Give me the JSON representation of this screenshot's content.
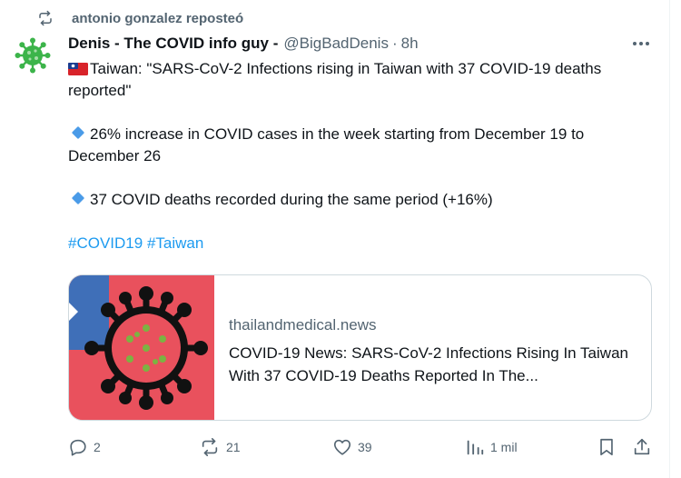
{
  "repost": {
    "text": "antonio gonzalez reposteó",
    "icon": "repost-icon"
  },
  "author": {
    "name": "Denis - The COVID info guy -",
    "handle": "@BigBadDenis",
    "separator": "·",
    "time": "8h",
    "avatar_icon": "virus-icon"
  },
  "tweet": {
    "line1": "Taiwan: \"SARS-CoV-2 Infections rising in Taiwan with 37 COVID-19 deaths reported\"",
    "line2": "26% increase in COVID cases in the week starting from December 19 to December 26",
    "line3": "37 COVID deaths recorded during the same period (+16%)",
    "hashtags": [
      "#COVID19",
      "#Taiwan"
    ]
  },
  "card": {
    "domain": "thailandmedical.news",
    "title": "COVID-19 News: SARS-CoV-2 Infections Rising In Taiwan With 37 COVID-19 Deaths Reported In The..."
  },
  "actions": {
    "replies": "2",
    "reposts": "21",
    "likes": "39",
    "views": "1 mil"
  },
  "colors": {
    "accent": "#1d9bf0",
    "secondary_text": "#536471",
    "border": "#cfd9de",
    "avatar_green": "#3cb44a"
  }
}
